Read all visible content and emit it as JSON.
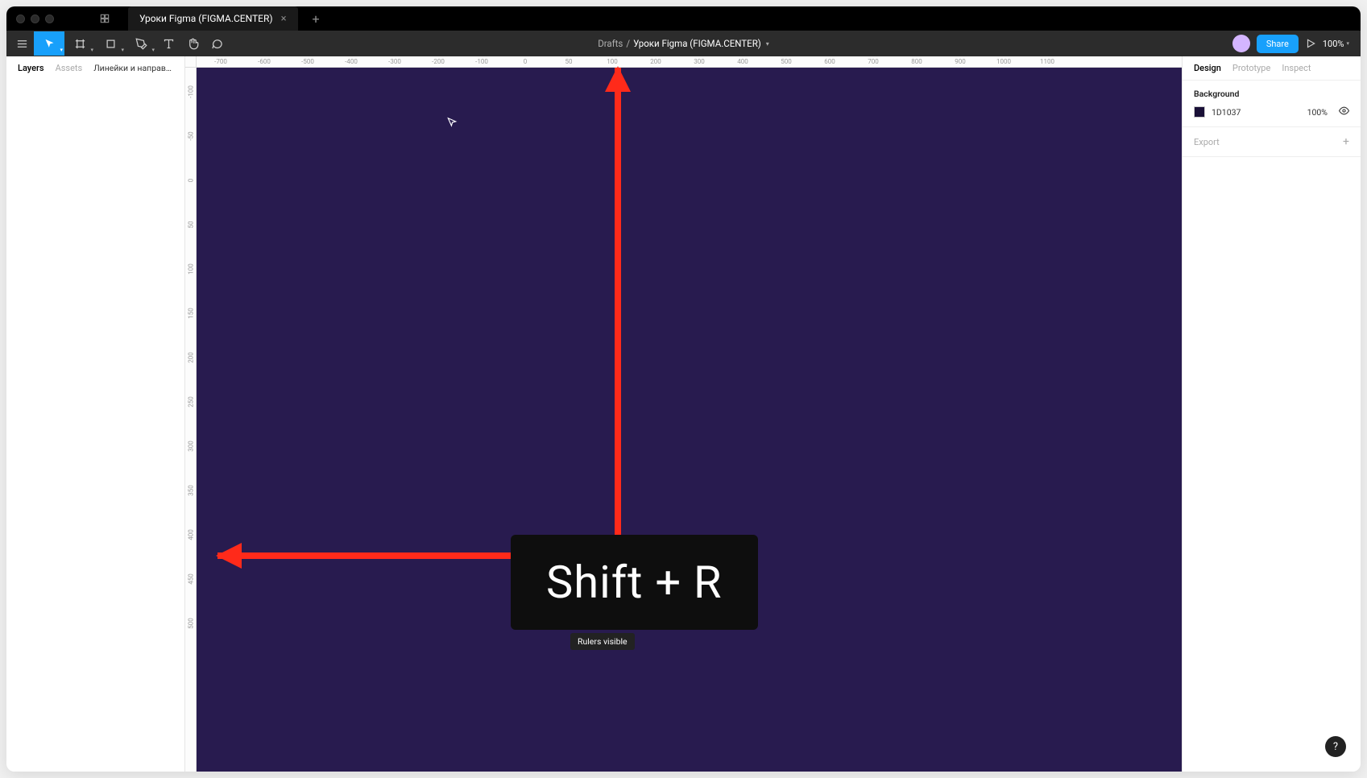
{
  "titlebar": {
    "tab_title": "Уроки Figma (FIGMA.CENTER)"
  },
  "toolbar": {
    "breadcrumb_root": "Drafts",
    "breadcrumb_sep": "/",
    "breadcrumb_active": "Уроки Figma (FIGMA.CENTER)",
    "share_label": "Share",
    "zoom_label": "100%"
  },
  "left_panel": {
    "tabs": {
      "layers": "Layers",
      "assets": "Assets"
    },
    "page_select": "Линейки и направляющие (включе..."
  },
  "right_panel": {
    "tabs": {
      "design": "Design",
      "prototype": "Prototype",
      "inspect": "Inspect"
    },
    "background": {
      "title": "Background",
      "hex": "1D1037",
      "opacity": "100%"
    },
    "export_label": "Export"
  },
  "ruler": {
    "h_ticks": [
      "-700",
      "-600",
      "-500",
      "-400",
      "-300",
      "-200",
      "-100",
      "0",
      "50",
      "100",
      "200",
      "300",
      "400",
      "500",
      "600",
      "700",
      "800",
      "900",
      "1000",
      "1100"
    ],
    "v_ticks": [
      "-100",
      "-50",
      "0",
      "50",
      "100",
      "150",
      "200",
      "250",
      "300",
      "350",
      "400",
      "450",
      "500"
    ]
  },
  "annotation": {
    "shortcut": "Shift + R",
    "tooltip": "Rulers visible"
  },
  "colors": {
    "canvas_bg": "#281b4f",
    "accent": "#18a0fb",
    "arrow": "#ff2a1a"
  },
  "help": "?"
}
